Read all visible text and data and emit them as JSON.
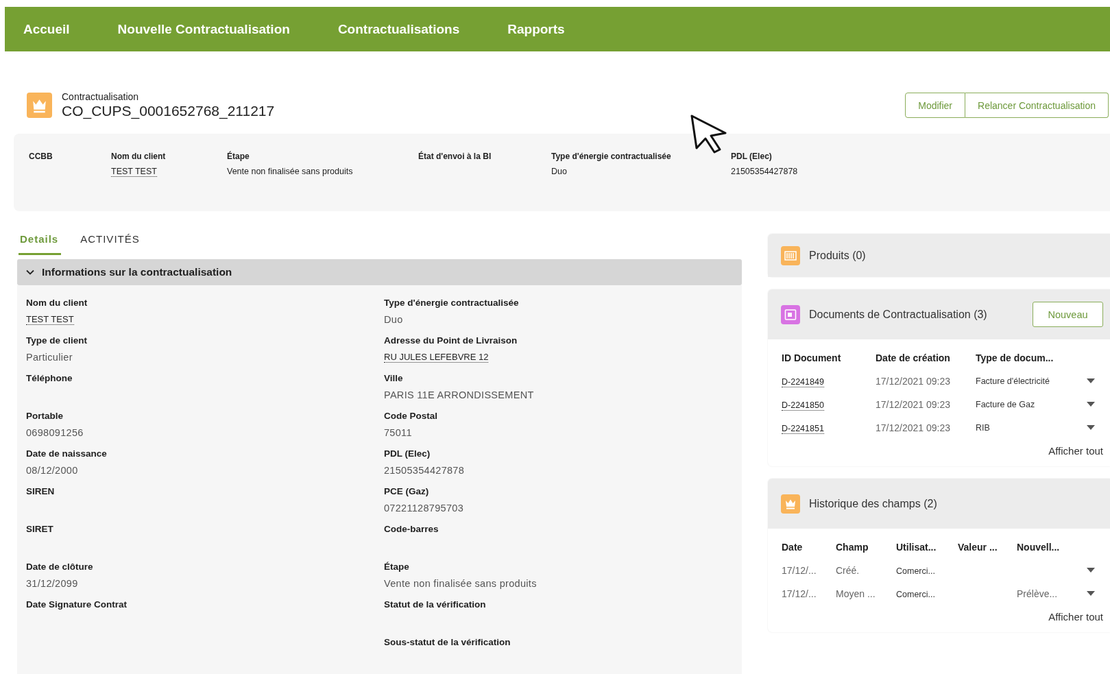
{
  "nav": [
    {
      "label": "Accueil"
    },
    {
      "label": "Nouvelle Contractualisation"
    },
    {
      "label": "Contractualisations"
    },
    {
      "label": "Rapports"
    }
  ],
  "record": {
    "type_label": "Contractualisation",
    "title": "CO_CUPS_0001652768_211217",
    "buttons": [
      "Modifier",
      "Relancer Contractualisation"
    ]
  },
  "highlights": [
    {
      "label": "CCBB"
    },
    {
      "label": "Nom du client",
      "value": "TEST TEST",
      "link": true
    },
    {
      "label": "Étape",
      "value": "Vente non finalisée sans produits",
      "link": false
    },
    {
      "label": "État d'envoi à la BI"
    },
    {
      "label": "Type d'énergie contractualisée",
      "value": "Duo",
      "link": false
    },
    {
      "label": "PDL (Elec)",
      "value": "21505354427878",
      "link": false
    }
  ],
  "tabs": [
    {
      "label": "Details",
      "selected": true
    },
    {
      "label": "ACTIVITÉS",
      "selected": false
    }
  ],
  "section": {
    "title": "Informations sur la contractualisation",
    "expanded": true,
    "left_column": [
      {
        "label": "Nom du client",
        "value": "TEST TEST",
        "link": true
      },
      {
        "label": "Type de client",
        "value": "Particulier",
        "link": false
      },
      {
        "label": "Téléphone"
      },
      {
        "label": "Portable",
        "value": "0698091256",
        "link": false
      },
      {
        "label": "Date de naissance",
        "value": "08/12/2000",
        "link": false
      },
      {
        "label": "SIREN"
      },
      {
        "label": "SIRET"
      },
      {
        "label": "Date de clôture",
        "value": "31/12/2099",
        "link": false
      },
      {
        "label": "Date Signature Contrat"
      }
    ],
    "right_column": [
      {
        "label": "Type d'énergie contractualisée",
        "value": "Duo",
        "link": false
      },
      {
        "label": "Adresse du Point de Livraison",
        "value": "RU JULES LEFEBVRE 12",
        "link": true
      },
      {
        "label": "Ville",
        "value": "PARIS 11E ARRONDISSEMENT",
        "link": false
      },
      {
        "label": "Code Postal",
        "value": "75011",
        "link": false
      },
      {
        "label": "PDL (Elec)",
        "value": "21505354427878",
        "link": false
      },
      {
        "label": "PCE (Gaz)",
        "value": "07221128795703",
        "link": false
      },
      {
        "label": "Code-barres"
      },
      {
        "label": "Étape",
        "value": "Vente non finalisée sans produits",
        "link": false
      },
      {
        "label": "Statut de la vérification"
      },
      {
        "label": "Sous-statut de la vérification"
      }
    ]
  },
  "products": {
    "title": "Produits (0)"
  },
  "documents": {
    "title": "Documents de Contractualisation (3)",
    "button": "Nouveau",
    "columns": [
      "ID Document",
      "Date de création",
      "Type de docum..."
    ],
    "rows": [
      {
        "id": "D-2241849",
        "date": "17/12/2021 09:23",
        "type": "Facture d'électricité"
      },
      {
        "id": "D-2241850",
        "date": "17/12/2021 09:23",
        "type": "Facture de Gaz"
      },
      {
        "id": "D-2241851",
        "date": "17/12/2021 09:23",
        "type": "RIB"
      }
    ],
    "footer": "Afficher tout"
  },
  "history": {
    "title": "Historique des champs (2)",
    "columns": [
      "Date",
      "Champ",
      "Utilisat...",
      "Valeur ...",
      "Nouvell..."
    ],
    "rows": [
      {
        "date": "17/12/...",
        "field": "Créé.",
        "user": "Comerci..."
      },
      {
        "date": "17/12/...",
        "field": "Moyen ...",
        "user": "Comerci...",
        "new_value": "Prélève..."
      }
    ],
    "footer": "Afficher tout"
  }
}
